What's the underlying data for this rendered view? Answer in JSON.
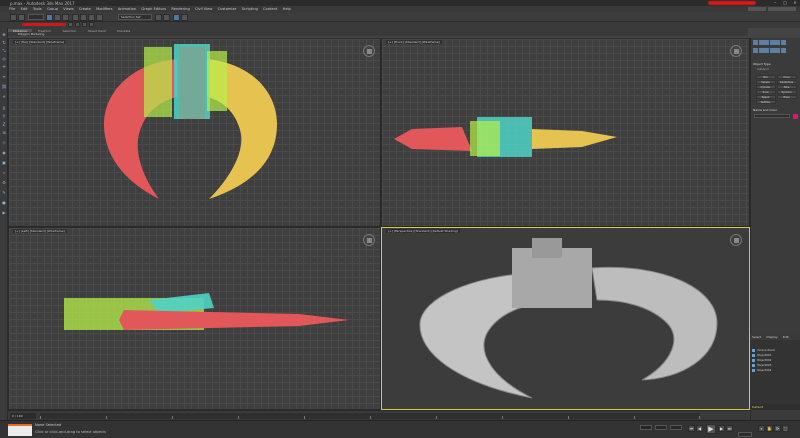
{
  "window": {
    "title": "p.max - Autodesk 3ds Max 2017"
  },
  "menu": [
    "File",
    "Edit",
    "Tools",
    "Group",
    "Views",
    "Create",
    "Modifiers",
    "Animation",
    "Graph Editors",
    "Rendering",
    "Civil View",
    "Customize",
    "Scripting",
    "Content",
    "Help"
  ],
  "ribbon": {
    "tabs": [
      "Modeling",
      "Freeform",
      "Selection",
      "Object Paint",
      "Populate"
    ],
    "active_tab": "Modeling",
    "row_label": "Polygon Modeling"
  },
  "viewports": {
    "top_label": "[+] [Top] [Standard] [Wireframe]",
    "front_label": "[+] [Front] [Standard] [Wireframe]",
    "left_label": "[+] [Left] [Standard] [Wireframe]",
    "persp_label": "[+] [Perspective] [Standard] [Default Shading]"
  },
  "command_panel": {
    "object_type_header": "Object Type",
    "autogrid": "AutoGrid",
    "objects": [
      "Box",
      "Cone",
      "Sphere",
      "GeoSphere",
      "Cylinder",
      "Tube",
      "Torus",
      "Pyramid",
      "Teapot",
      "Plane",
      "TextPlus"
    ],
    "name_color_header": "Name and Color",
    "swatch_color": "#e0127a"
  },
  "scene_explorer": {
    "tabs": [
      "Select",
      "Display",
      "Edit"
    ],
    "items": [
      "(Scene Root)",
      "Object001",
      "Object002",
      "Object003",
      "Object004"
    ],
    "workspace": "Default"
  },
  "timeline": {
    "frame": "0 / 100"
  },
  "status": {
    "line1": "None Selected",
    "line2": "Click or click-and-drag to select objects",
    "selection_mode": "Selection Set"
  },
  "colors": {
    "red": "#e2575a",
    "yellow": "#e6c350",
    "cyan": "#4fd3c5",
    "lime": "#b7f04a",
    "active_border": "#d9c74c"
  }
}
